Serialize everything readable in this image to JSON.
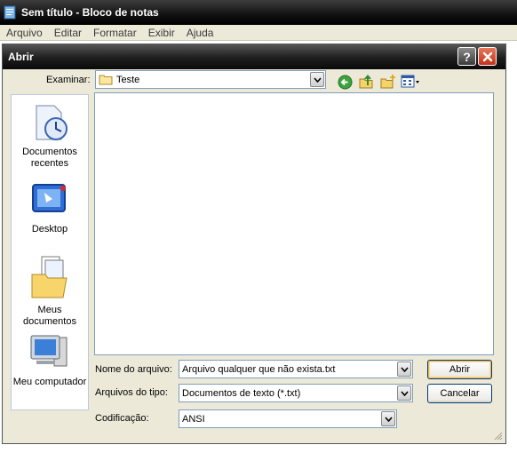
{
  "notepad": {
    "title": "Sem título - Bloco de notas",
    "menu": [
      "Arquivo",
      "Editar",
      "Formatar",
      "Exibir",
      "Ajuda"
    ]
  },
  "dialog": {
    "title": "Abrir",
    "look_in_label": "Examinar:",
    "look_in_value": "Teste",
    "places": [
      "Documentos recentes",
      "Desktop",
      "Meus documentos",
      "Meu computador"
    ],
    "filename_label": "Nome do arquivo:",
    "filename_value": "Arquivo qualquer que não exista.txt",
    "filetype_label": "Arquivos do tipo:",
    "filetype_value": "Documentos de texto (*.txt)",
    "encoding_label": "Codificação:",
    "encoding_value": "ANSI",
    "open_button": "Abrir",
    "cancel_button": "Cancelar",
    "help_glyph": "?"
  },
  "icons": [
    "back-icon",
    "up-folder-icon",
    "new-folder-icon",
    "views-menu-icon"
  ]
}
